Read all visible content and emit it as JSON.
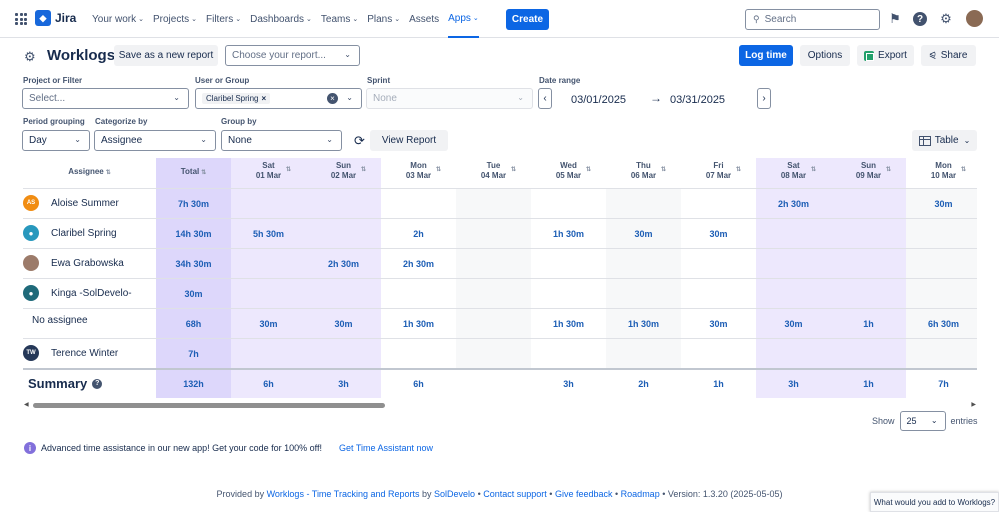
{
  "topnav": {
    "logo": "Jira",
    "items": [
      {
        "label": "Your work",
        "chev": true
      },
      {
        "label": "Projects",
        "chev": true
      },
      {
        "label": "Filters",
        "chev": true
      },
      {
        "label": "Dashboards",
        "chev": true
      },
      {
        "label": "Teams",
        "chev": true
      },
      {
        "label": "Plans",
        "chev": true
      },
      {
        "label": "Assets",
        "chev": false
      },
      {
        "label": "Apps",
        "chev": true,
        "active": true
      }
    ],
    "create_label": "Create",
    "search_placeholder": "Search"
  },
  "header": {
    "title": "Worklogs",
    "save_label": "Save as a new report",
    "choose_placeholder": "Choose your report...",
    "log_time_label": "Log time",
    "options_label": "Options",
    "export_label": "Export",
    "share_label": "Share"
  },
  "filters": {
    "project_label": "Project or Filter",
    "project_placeholder": "Select...",
    "user_label": "User or Group",
    "user_chip": "Claribel Spring",
    "sprint_label": "Sprint",
    "sprint_value": "None",
    "date_label": "Date range",
    "date_from": "03/01/2025",
    "date_to": "03/31/2025",
    "period_label": "Period grouping",
    "period_value": "Day",
    "categorize_label": "Categorize by",
    "categorize_value": "Assignee",
    "group_label": "Group by",
    "group_value": "None",
    "view_report_label": "View Report",
    "table_label": "Table"
  },
  "grid": {
    "assignee_header": "Assignee",
    "total_header": "Total",
    "columns": [
      {
        "day": "Sat",
        "date": "01 Mar",
        "weekend": true
      },
      {
        "day": "Sun",
        "date": "02 Mar",
        "weekend": true
      },
      {
        "day": "Mon",
        "date": "03 Mar",
        "weekend": false
      },
      {
        "day": "Tue",
        "date": "04 Mar",
        "weekend": false
      },
      {
        "day": "Wed",
        "date": "05 Mar",
        "weekend": false
      },
      {
        "day": "Thu",
        "date": "06 Mar",
        "weekend": false
      },
      {
        "day": "Fri",
        "date": "07 Mar",
        "weekend": false
      },
      {
        "day": "Sat",
        "date": "08 Mar",
        "weekend": true
      },
      {
        "day": "Sun",
        "date": "09 Mar",
        "weekend": true
      },
      {
        "day": "Mon",
        "date": "10 Mar",
        "weekend": false
      }
    ],
    "rows": [
      {
        "name": "Aloise Summer",
        "avatar": {
          "type": "initials",
          "text": "AS",
          "color": "#f18d13"
        },
        "total": "7h 30m",
        "cells": [
          "",
          "",
          "",
          "",
          "",
          "",
          "",
          "2h 30m",
          "",
          "30m"
        ]
      },
      {
        "name": "Claribel Spring",
        "avatar": {
          "type": "icon",
          "text": "",
          "color": "#2898bd"
        },
        "total": "14h 30m",
        "cells": [
          "5h 30m",
          "",
          "2h",
          "",
          "1h 30m",
          "30m",
          "30m",
          "",
          "",
          ""
        ]
      },
      {
        "name": "Ewa Grabowska",
        "avatar": {
          "type": "photo",
          "text": "",
          "color": "#9c7b6a"
        },
        "total": "34h 30m",
        "cells": [
          "",
          "2h 30m",
          "2h 30m",
          "",
          "",
          "",
          "",
          "",
          "",
          ""
        ]
      },
      {
        "name": "Kinga -SolDevelo-",
        "avatar": {
          "type": "icon",
          "text": "",
          "color": "#1f6a7a"
        },
        "total": "30m",
        "cells": [
          "",
          "",
          "",
          "",
          "",
          "",
          "",
          "",
          "",
          ""
        ]
      },
      {
        "name": "No assignee",
        "avatar": null,
        "total": "68h",
        "cells": [
          "30m",
          "30m",
          "1h 30m",
          "",
          "1h 30m",
          "1h 30m",
          "30m",
          "30m",
          "1h",
          "6h 30m"
        ]
      },
      {
        "name": "Terence Winter",
        "avatar": {
          "type": "initials",
          "text": "TW",
          "color": "#253858"
        },
        "total": "7h",
        "cells": [
          "",
          "",
          "",
          "",
          "",
          "",
          "",
          "",
          "",
          ""
        ]
      }
    ],
    "summary": {
      "label": "Summary",
      "total": "132h",
      "cells": [
        "6h",
        "3h",
        "6h",
        "",
        "3h",
        "2h",
        "1h",
        "3h",
        "1h",
        "7h"
      ]
    }
  },
  "pagination": {
    "show_label": "Show",
    "page_size": "25",
    "entries_label": "entries"
  },
  "promo": {
    "text": "Advanced time assistance in our new app! Get your code for 100% off!",
    "link": "Get Time Assistant now"
  },
  "footer": {
    "provided_by": "Provided by",
    "app_link": "Worklogs - Time Tracking and Reports",
    "by": "by",
    "vendor_link": "SolDevelo",
    "support_link": "Contact support",
    "feedback_link": "Give feedback",
    "roadmap_link": "Roadmap",
    "version": "Version: 1.3.20 (2025-05-05)"
  },
  "feedback_tab": "What would you add to Worklogs?",
  "colors": {
    "accent": "#0c66e4",
    "weekend_col": "#ede8fd",
    "total_col": "#ddd7fb",
    "value_text": "#1d5eb5"
  }
}
